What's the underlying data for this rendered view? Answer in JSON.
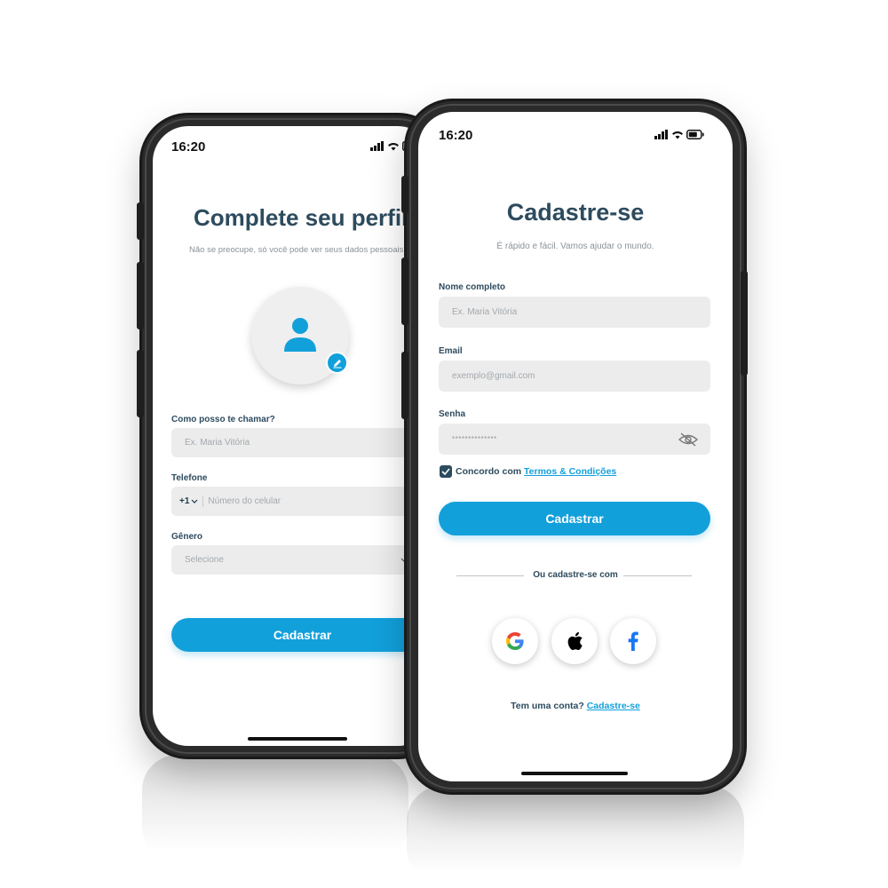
{
  "back_phone": {
    "status_time": "16:20",
    "title": "Complete seu perfil",
    "subtitle": "Não se preocupe, só você pode ver seus dados pessoais",
    "name_label": "Como posso te chamar?",
    "name_placeholder": "Ex. Maria Vitória",
    "phone_label": "Telefone",
    "phone_prefix": "+1",
    "phone_placeholder": "Número do celular",
    "gender_label": "Gênero",
    "gender_placeholder": "Selecione",
    "submit_label": "Cadastrar"
  },
  "front_phone": {
    "status_time": "16:20",
    "title": "Cadastre-se",
    "subtitle": "É rápido e fácil. Vamos ajudar o mundo.",
    "name_label": "Nome completo",
    "name_placeholder": "Ex. Maria Vitória",
    "email_label": "Email",
    "email_placeholder": "exemplo@gmail.com",
    "password_label": "Senha",
    "password_value": "**************",
    "agree_text": "Concordo com",
    "terms_link": "Termos & Condições",
    "submit_label": "Cadastrar",
    "divider_text": "Ou cadastre-se com",
    "account_text": "Tem uma conta?",
    "account_link": "Cadastre-se"
  },
  "colors": {
    "accent": "#12a0db",
    "title": "#2d4b5e",
    "field_bg": "#ececec"
  },
  "icons": [
    "avatar-placeholder-icon",
    "edit-pencil-icon",
    "eye-off-icon",
    "checkbox-checked-icon",
    "google-icon",
    "apple-icon",
    "facebook-icon",
    "chevron-down-icon",
    "signal-icon",
    "wifi-icon",
    "battery-icon"
  ]
}
